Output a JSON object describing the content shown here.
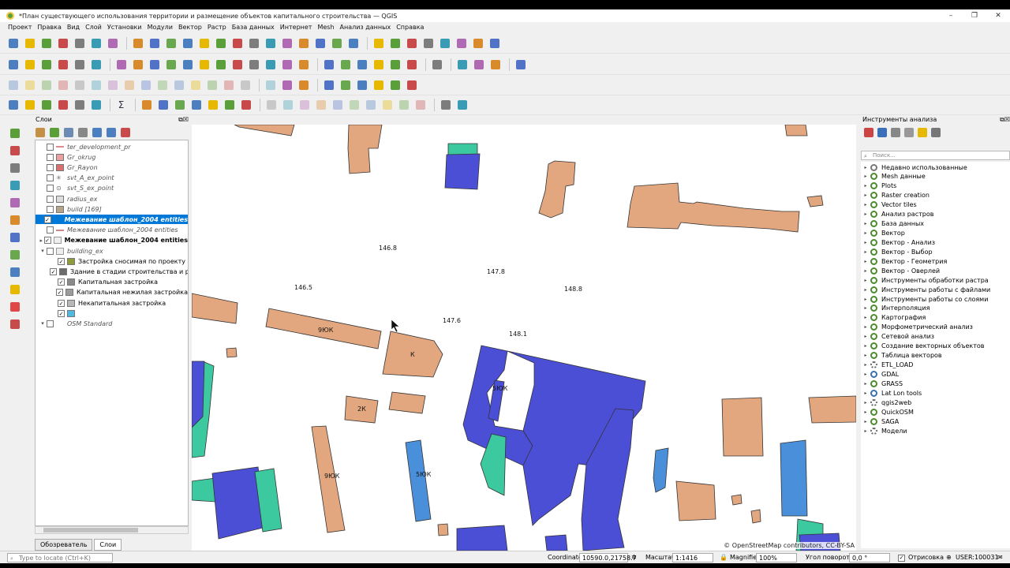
{
  "window": {
    "title": "*План существующего использования территории  и размещение объектов капитального строительства — QGIS",
    "controls": [
      "–",
      "❐",
      "✕"
    ]
  },
  "menu": [
    "Проект",
    "Правка",
    "Вид",
    "Слой",
    "Установки",
    "Модули",
    "Вектор",
    "Растр",
    "База данных",
    "Интернет",
    "Mesh",
    "Анализ данных",
    "Справка"
  ],
  "layers_panel": {
    "title": "Слои",
    "buttons": "⧉☒",
    "layers": [
      {
        "label": "ter_development_pr",
        "checked": false,
        "style": "it",
        "symbol": "line",
        "color": "#e08a8a",
        "arrow": ""
      },
      {
        "label": "Gr_okrug",
        "checked": false,
        "style": "it",
        "symbol": "poly",
        "color": "#e9a0a0",
        "arrow": ""
      },
      {
        "label": "Gr_Rayon",
        "checked": false,
        "style": "it",
        "symbol": "poly",
        "color": "#d87070",
        "arrow": ""
      },
      {
        "label": "svt_A_ex_point",
        "checked": false,
        "style": "it",
        "symbol": "star",
        "color": "#666666",
        "arrow": ""
      },
      {
        "label": "svt_S_ex_point",
        "checked": false,
        "style": "it",
        "symbol": "circle",
        "color": "#666666",
        "arrow": ""
      },
      {
        "label": "radius_ex",
        "checked": false,
        "style": "it",
        "symbol": "poly",
        "color": "#dddddd",
        "arrow": ""
      },
      {
        "label": "build [169]",
        "checked": false,
        "style": "it",
        "symbol": "poly",
        "color": "#b5a58a",
        "arrow": ""
      },
      {
        "label": "Межевание шаблон_2004 entities",
        "checked": true,
        "style": "sel",
        "symbol": "dot",
        "color": "#0078d7",
        "arrow": ""
      },
      {
        "label": "Межевание шаблон_2004 entities",
        "checked": false,
        "style": "it",
        "symbol": "line",
        "color": "#cc8888",
        "arrow": ""
      },
      {
        "label": "Межевание шаблон_2004 entities",
        "checked": true,
        "style": "b",
        "symbol": "group",
        "color": "#999999",
        "arrow": "▸"
      },
      {
        "label": "building_ex",
        "checked": false,
        "style": "it",
        "symbol": "group",
        "color": "#999999",
        "arrow": "▾"
      },
      {
        "label": "Застройка сносимая по проекту",
        "checked": true,
        "style": "",
        "symbol": "poly",
        "color": "#8f9a3a",
        "arrow": "",
        "indent": true
      },
      {
        "label": "Здание в стадии строительства и реко",
        "checked": true,
        "style": "",
        "symbol": "poly",
        "color": "#6b6b6b",
        "arrow": "",
        "indent": true
      },
      {
        "label": "Капитальная застройка",
        "checked": true,
        "style": "",
        "symbol": "poly",
        "color": "#8a8a8a",
        "arrow": "",
        "indent": true
      },
      {
        "label": "Капитальная нежилая застройка",
        "checked": true,
        "style": "",
        "symbol": "poly",
        "color": "#9c9c9c",
        "arrow": "",
        "indent": true
      },
      {
        "label": "Некапитальная застройка",
        "checked": true,
        "style": "",
        "symbol": "poly",
        "color": "#b8b8b8",
        "arrow": "",
        "indent": true
      },
      {
        "label": "",
        "checked": true,
        "style": "",
        "symbol": "poly",
        "color": "#4fb8e0",
        "arrow": "",
        "indent": true
      },
      {
        "label": "OSM Standard",
        "checked": false,
        "style": "it",
        "symbol": "none",
        "color": "#ffffff",
        "arrow": "▾"
      }
    ],
    "tabs": [
      "Обозреватель",
      "Слои"
    ],
    "active_tab": 1
  },
  "map": {
    "labels": [
      {
        "text": "146.8"
      },
      {
        "text": "147.8"
      },
      {
        "text": "146.5"
      },
      {
        "text": "148.8"
      },
      {
        "text": "147.6"
      },
      {
        "text": "148.1"
      },
      {
        "text": "9ЮК"
      },
      {
        "text": "К"
      },
      {
        "text": "5ЮК"
      },
      {
        "text": "2К"
      },
      {
        "text": "9ЮК"
      },
      {
        "text": "5ЮК"
      }
    ],
    "attribution": "© OpenStreetMap contributors, CC-BY-SA",
    "colors": {
      "salmon": "#e3a77f",
      "blue": "#4b4fd6",
      "teal": "#3dc9a0",
      "light_blue": "#4a8fd9"
    }
  },
  "processing_panel": {
    "title": "Инструменты анализа",
    "buttons": "⧉☒",
    "search_placeholder": "Поиск...",
    "items": [
      {
        "label": "Недавно использованные",
        "icon": "clock"
      },
      {
        "label": "Mesh данные",
        "icon": "q"
      },
      {
        "label": "Plots",
        "icon": "q"
      },
      {
        "label": "Raster creation",
        "icon": "q"
      },
      {
        "label": "Vector tiles",
        "icon": "q"
      },
      {
        "label": "Анализ растров",
        "icon": "q"
      },
      {
        "label": "База данных",
        "icon": "q"
      },
      {
        "label": "Вектор",
        "icon": "q"
      },
      {
        "label": "Вектор - Анализ",
        "icon": "q"
      },
      {
        "label": "Вектор - Выбор",
        "icon": "q"
      },
      {
        "label": "Вектор - Геометрия",
        "icon": "q"
      },
      {
        "label": "Вектор - Оверлей",
        "icon": "q"
      },
      {
        "label": "Инструменты обработки растра",
        "icon": "q"
      },
      {
        "label": "Инструменты работы с файлами",
        "icon": "q"
      },
      {
        "label": "Инструменты работы со слоями",
        "icon": "q"
      },
      {
        "label": "Интерполяция",
        "icon": "q"
      },
      {
        "label": "Картография",
        "icon": "q"
      },
      {
        "label": "Морфометрический анализ",
        "icon": "q"
      },
      {
        "label": "Сетевой анализ",
        "icon": "q"
      },
      {
        "label": "Создание векторных объектов",
        "icon": "q"
      },
      {
        "label": "Таблица векторов",
        "icon": "q"
      },
      {
        "label": "ETL_LOAD",
        "icon": "gear"
      },
      {
        "label": "GDAL",
        "icon": "blue"
      },
      {
        "label": "GRASS",
        "icon": "q"
      },
      {
        "label": "Lat Lon tools",
        "icon": "blue"
      },
      {
        "label": "qgis2web",
        "icon": "gear"
      },
      {
        "label": "QuickOSM",
        "icon": "q"
      },
      {
        "label": "SAGA",
        "icon": "q"
      },
      {
        "label": "Модели",
        "icon": "gear"
      }
    ]
  },
  "statusbar": {
    "locator_placeholder": "Type to locate (Ctrl+K)",
    "coordinate_label": "Coordinate",
    "coordinate_value": "10590.0,21758.7",
    "scale_label": "Масштаб",
    "scale_value": "1:1416",
    "magnifier_label": "Magnifier",
    "magnifier_value": "100%",
    "rotation_label": "Угол поворота",
    "rotation_value": "0,0 °",
    "render_label": "Отрисовка",
    "crs_label": "USER:100031"
  }
}
